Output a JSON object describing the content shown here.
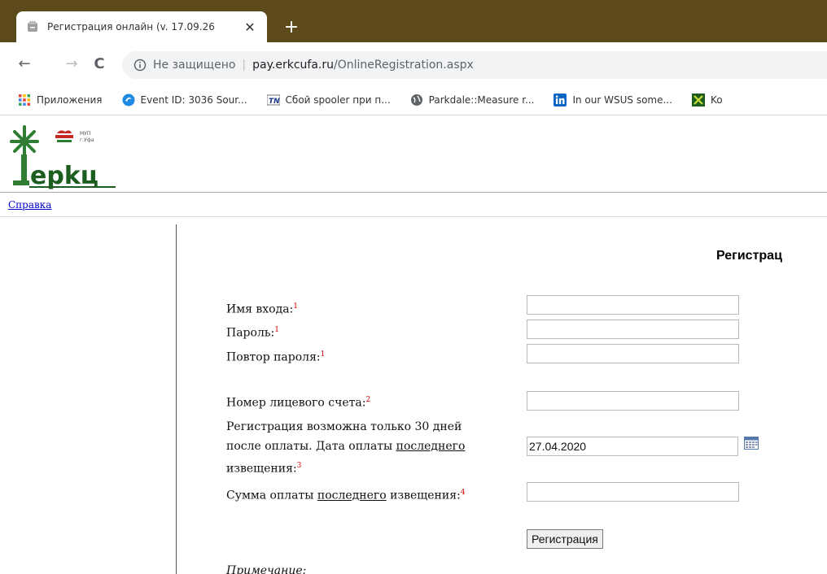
{
  "browser": {
    "tab_title": "Регистрация онлайн (v. 17.09.26",
    "tab_close": "✕",
    "new_tab": "+",
    "back": "←",
    "forward": "→",
    "reload": "C",
    "security_label": "Не защищено",
    "omnibox_separator": "|",
    "url_host": "pay.erkcufa.ru",
    "url_path": "/OnlineRegistration.aspx",
    "bookmarks": [
      {
        "label": "Приложения",
        "icon": "apps-grid-icon"
      },
      {
        "label": "Event ID: 3036 Sour...",
        "icon": "circle-logo-icon"
      },
      {
        "label": "Сбой spooler при п...",
        "icon": "tn-icon"
      },
      {
        "label": "Parkdale::Measure r...",
        "icon": "globe-icon"
      },
      {
        "label": "In our WSUS some...",
        "icon": "linkedin-icon"
      },
      {
        "label": "Ko",
        "icon": "green-x-icon"
      }
    ]
  },
  "logo": {
    "small_text_1": "МУП",
    "small_text_2": "г.Уфа",
    "wordmark": "ерkц"
  },
  "nav": {
    "help_link": "Справка"
  },
  "form": {
    "title": "Регистрац",
    "login_label": "Имя входа:",
    "login_mark": "1",
    "login_value": "",
    "password_label": "Пароль:",
    "password_mark": "1",
    "password_value": "",
    "repeat_label": "Повтор пароля:",
    "repeat_mark": "1",
    "repeat_value": "",
    "account_label": "Номер лицевого счета:",
    "account_mark": "2",
    "account_value": "",
    "date_line1": "Регистрация возможна только 30 дней",
    "date_line2_a": "после оплаты. Дата оплаты ",
    "date_line2_u": "последнего",
    "date_line3": "извещения:",
    "date_mark": "3",
    "date_value": "27.04.2020",
    "sum_label_a": "Сумма оплаты ",
    "sum_label_u": "последнего",
    "sum_label_b": " извещения:",
    "sum_mark": "4",
    "sum_value": "",
    "register_button": "Регистрация",
    "note": "Примечание:"
  },
  "colors": {
    "tabstrip": "#5c4a1c",
    "link": "#0000cc",
    "footnote_mark": "#d00000",
    "logo_green": "#2e7d32"
  }
}
